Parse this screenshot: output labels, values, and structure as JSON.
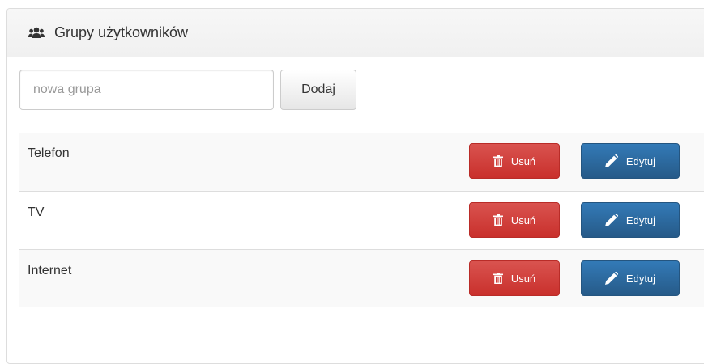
{
  "panel": {
    "icon": "users-icon",
    "title": "Grupy użytkowników"
  },
  "add_form": {
    "input_placeholder": "nowa grupa",
    "input_value": "",
    "add_button_label": "Dodaj"
  },
  "groups": [
    {
      "name": "Telefon",
      "delete_label": "Usuń",
      "edit_label": "Edytuj"
    },
    {
      "name": "TV",
      "delete_label": "Usuń",
      "edit_label": "Edytuj"
    },
    {
      "name": "Internet",
      "delete_label": "Usuń",
      "edit_label": "Edytuj"
    }
  ],
  "colors": {
    "delete_button": "#d9534f",
    "edit_button": "#337ab7",
    "row_stripe": "#f9f9f9"
  },
  "icons": {
    "delete": "trash-icon",
    "edit": "pencil-icon"
  }
}
